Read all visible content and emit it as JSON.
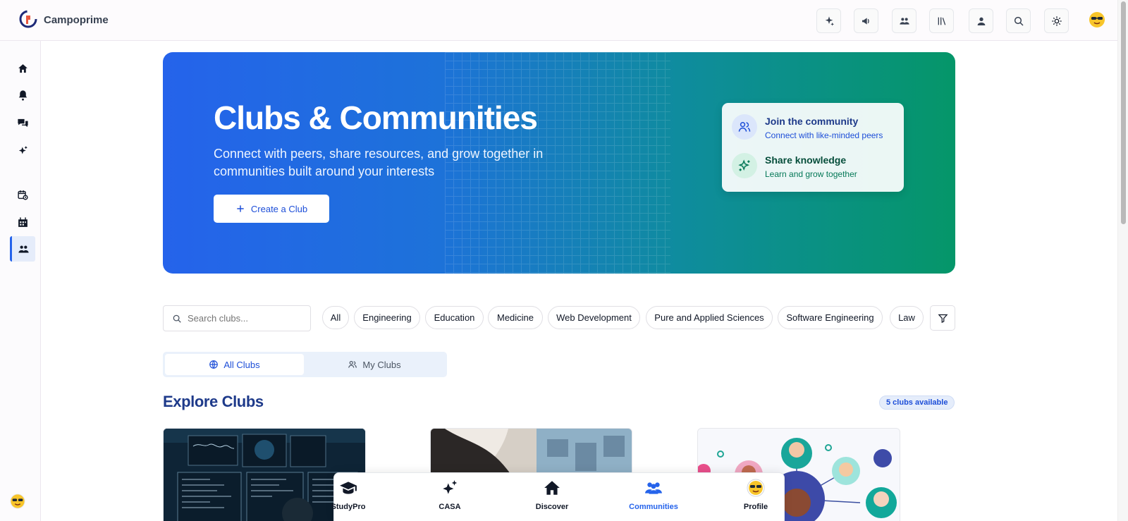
{
  "app": {
    "brand": "Campoprime"
  },
  "topbar": {
    "buttons": [
      {
        "icon": "sparkles-icon"
      },
      {
        "icon": "megaphone-icon"
      },
      {
        "icon": "users-icon"
      },
      {
        "icon": "library-icon"
      },
      {
        "icon": "user-square-icon"
      },
      {
        "icon": "search-icon"
      },
      {
        "icon": "sun-icon"
      }
    ]
  },
  "sidebar": {
    "items": [
      {
        "icon": "home-icon"
      },
      {
        "icon": "bell-icon"
      },
      {
        "icon": "chat-icon"
      },
      {
        "icon": "sparkles-icon"
      },
      {
        "icon": "calendar-clock-icon"
      },
      {
        "icon": "calendar-icon"
      },
      {
        "icon": "users-icon",
        "active": true
      }
    ]
  },
  "hero": {
    "title": "Clubs & Communities",
    "subtitle": "Connect with peers, share resources, and grow together in communities built around your interests",
    "cta": "Create a Club",
    "card": {
      "join_title": "Join the community",
      "join_text": "Connect with like-minded peers",
      "share_title": "Share knowledge",
      "share_text": "Learn and grow together"
    }
  },
  "filters": {
    "search_placeholder": "Search clubs...",
    "categories": [
      "All",
      "Engineering",
      "Education",
      "Medicine",
      "Web Development",
      "Pure and Applied Sciences",
      "Software Engineering",
      "Law"
    ]
  },
  "tabs": {
    "all": "All Clubs",
    "mine": "My Clubs"
  },
  "section": {
    "title": "Explore Clubs",
    "count": "5 clubs available"
  },
  "dock": {
    "items": [
      {
        "label": "StudyPro",
        "icon": "graduation-cap-icon"
      },
      {
        "label": "CASA",
        "icon": "sparkles-icon"
      },
      {
        "label": "Discover",
        "icon": "home-icon"
      },
      {
        "label": "Communities",
        "icon": "users-icon",
        "active": true
      },
      {
        "label": "Profile",
        "icon": "avatar"
      }
    ]
  },
  "colors": {
    "accent": "#2563eb",
    "hero_start": "#2563eb",
    "hero_end": "#059669",
    "title_navy": "#1e3a8a"
  }
}
